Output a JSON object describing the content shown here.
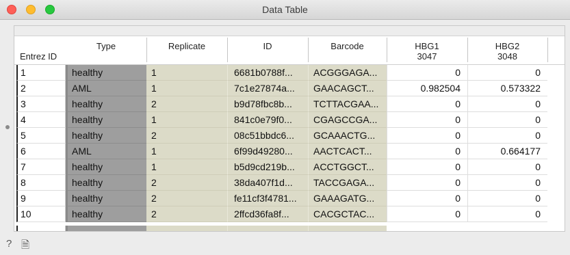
{
  "window": {
    "title": "Data Table"
  },
  "table": {
    "header_corner": "Entrez ID",
    "columns": [
      {
        "label": "Type",
        "sub": ""
      },
      {
        "label": "Replicate",
        "sub": ""
      },
      {
        "label": "ID",
        "sub": ""
      },
      {
        "label": "Barcode",
        "sub": ""
      },
      {
        "label": "HBG1",
        "sub": "3047"
      },
      {
        "label": "HBG2",
        "sub": "3048"
      }
    ],
    "rows": [
      {
        "idx": "1",
        "type": "healthy",
        "replicate": "1",
        "id": "6681b0788f...",
        "barcode": "ACGGGAGA...",
        "hbg1": "0",
        "hbg2": "0"
      },
      {
        "idx": "2",
        "type": "AML",
        "replicate": "1",
        "id": "7c1e27874a...",
        "barcode": "GAACAGCT...",
        "hbg1": "0.982504",
        "hbg2": "0.573322"
      },
      {
        "idx": "3",
        "type": "healthy",
        "replicate": "2",
        "id": "b9d78fbc8b...",
        "barcode": "TCTTACGAA...",
        "hbg1": "0",
        "hbg2": "0"
      },
      {
        "idx": "4",
        "type": "healthy",
        "replicate": "1",
        "id": "841c0e79f0...",
        "barcode": "CGAGCCGA...",
        "hbg1": "0",
        "hbg2": "0"
      },
      {
        "idx": "5",
        "type": "healthy",
        "replicate": "2",
        "id": "08c51bbdc6...",
        "barcode": "GCAAACTG...",
        "hbg1": "0",
        "hbg2": "0"
      },
      {
        "idx": "6",
        "type": "AML",
        "replicate": "1",
        "id": "6f99d49280...",
        "barcode": "AACTCACT...",
        "hbg1": "0",
        "hbg2": "0.664177"
      },
      {
        "idx": "7",
        "type": "healthy",
        "replicate": "1",
        "id": "b5d9cd219b...",
        "barcode": "ACCTGGCT...",
        "hbg1": "0",
        "hbg2": "0"
      },
      {
        "idx": "8",
        "type": "healthy",
        "replicate": "2",
        "id": "38da407f1d...",
        "barcode": "TACCGAGA...",
        "hbg1": "0",
        "hbg2": "0"
      },
      {
        "idx": "9",
        "type": "healthy",
        "replicate": "2",
        "id": "fe11cf3f4781...",
        "barcode": "GAAAGATG...",
        "hbg1": "0",
        "hbg2": "0"
      },
      {
        "idx": "10",
        "type": "healthy",
        "replicate": "2",
        "id": "2ffcd36fa8f...",
        "barcode": "CACGCTAC...",
        "hbg1": "0",
        "hbg2": "0"
      }
    ]
  },
  "statusbar": {
    "help_icon": "question-mark-icon",
    "report_icon": "document-icon",
    "help_glyph": "?",
    "report_glyph": "🗎"
  },
  "colors": {
    "meta_bg": "#9e9e9e",
    "attr_bg": "#dcdbc8",
    "close": "#fe5f57",
    "minimize": "#febc2e",
    "maximize": "#28c840"
  }
}
